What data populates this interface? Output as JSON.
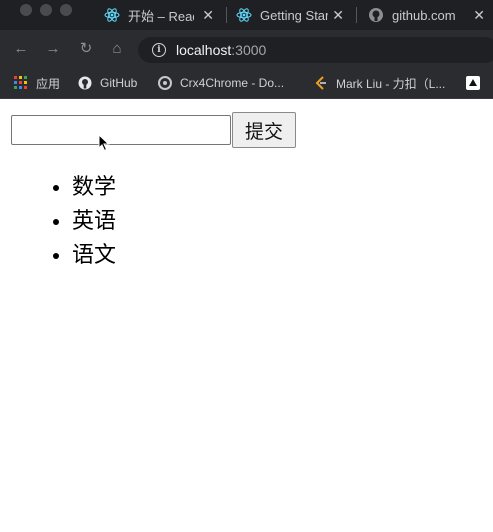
{
  "browser": {
    "tabs": [
      {
        "title": "开始 – React",
        "icon": "react-icon"
      },
      {
        "title": "Getting Started",
        "icon": "react-icon"
      },
      {
        "title": "github.com",
        "icon": "github-icon"
      }
    ],
    "address": {
      "host": "localhost",
      "port": ":3000"
    },
    "bookmarks": [
      {
        "label": "应用",
        "icon": "apps-grid-icon"
      },
      {
        "label": "GitHub",
        "icon": "github-icon"
      },
      {
        "label": "Crx4Chrome - Do...",
        "icon": "crx4chrome-icon"
      },
      {
        "label": "Mark Liu - 力扣（L...",
        "icon": "leetcode-icon"
      }
    ]
  },
  "page": {
    "input": {
      "value": "",
      "placeholder": ""
    },
    "submit_label": "提交",
    "items": [
      "数学",
      "英语",
      "语文"
    ]
  },
  "colors": {
    "react_teal": "#61dafb",
    "chrome_dark": "#2b2c30"
  }
}
